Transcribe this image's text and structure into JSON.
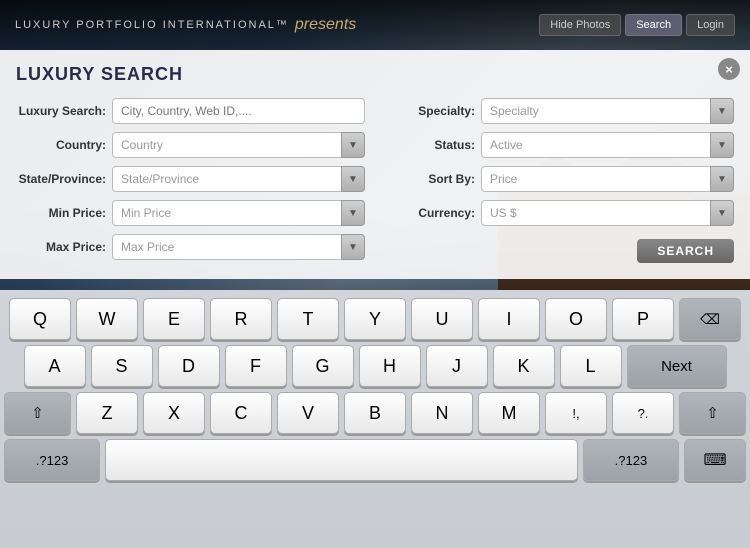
{
  "app": {
    "logo_text": "LUXURY PORTFOLIO INTERNATIONAL™",
    "logo_presents": "presents",
    "nav_buttons": [
      {
        "label": "Hide Photos",
        "id": "hide-photos"
      },
      {
        "label": "Search",
        "id": "search",
        "active": true
      },
      {
        "label": "Login",
        "id": "login"
      }
    ],
    "close_label": "×"
  },
  "search_panel": {
    "title": "LUXURY SEARCH",
    "rows": [
      {
        "left": {
          "label": "Luxury Search:",
          "placeholder": "City, Country, Web ID,....",
          "type": "text",
          "has_dropdown": false
        },
        "right": {
          "label": "Specialty:",
          "value": "Specialty",
          "type": "dropdown"
        }
      },
      {
        "left": {
          "label": "Country:",
          "value": "Country",
          "type": "dropdown"
        },
        "right": {
          "label": "Status:",
          "value": "Active",
          "type": "dropdown"
        }
      },
      {
        "left": {
          "label": "State/Province:",
          "value": "State/Province",
          "type": "dropdown"
        },
        "right": {
          "label": "Sort By:",
          "value": "Price",
          "type": "dropdown"
        }
      },
      {
        "left": {
          "label": "Min Price:",
          "value": "Min Price",
          "type": "dropdown"
        },
        "right": {
          "label": "Currency:",
          "value": "US $",
          "type": "dropdown"
        }
      },
      {
        "left": {
          "label": "Max Price:",
          "value": "Max Price",
          "type": "dropdown"
        },
        "right": {
          "search_button": true,
          "label": "SEARCH"
        }
      }
    ]
  },
  "keyboard": {
    "rows": [
      [
        "Q",
        "W",
        "E",
        "R",
        "T",
        "Y",
        "U",
        "I",
        "O",
        "P"
      ],
      [
        "A",
        "S",
        "D",
        "F",
        "G",
        "H",
        "J",
        "K",
        "L"
      ],
      [
        "⇧",
        "Z",
        "X",
        "C",
        "V",
        "B",
        "N",
        "M",
        "!,",
        "?.",
        "⇧"
      ],
      [
        ".?123",
        " ",
        ".?123",
        "⌨"
      ]
    ],
    "special": {
      "backspace": "⌫",
      "next": "Next",
      "shift": "⇧",
      "space": " ",
      "numbers": ".?123",
      "keyboard_icon": "⌨"
    }
  }
}
